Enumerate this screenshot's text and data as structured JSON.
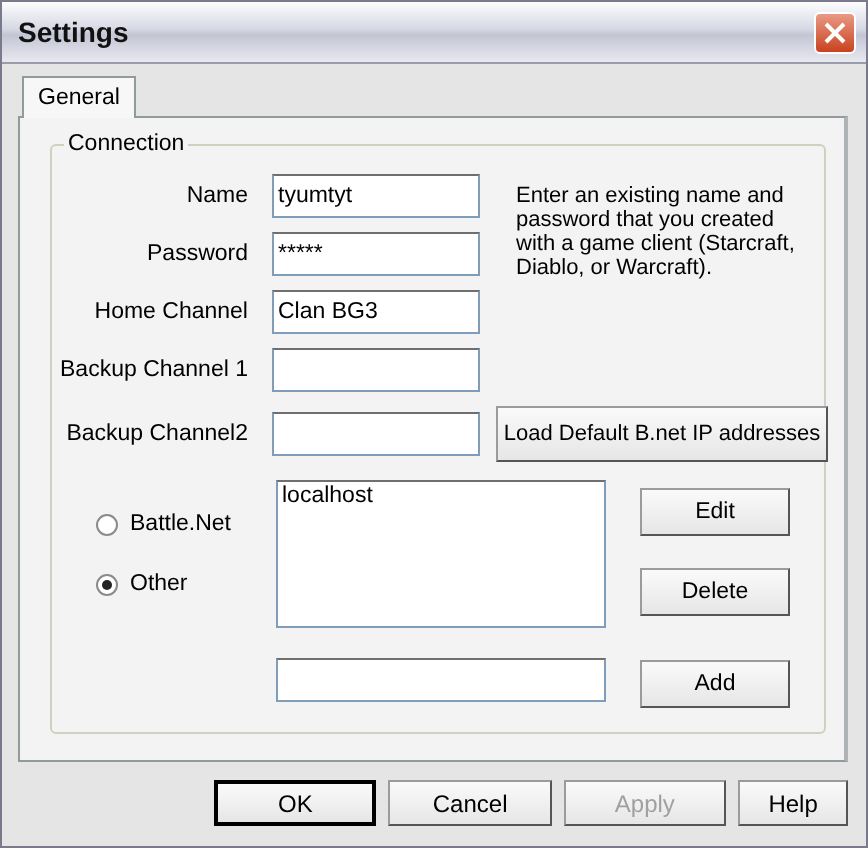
{
  "window": {
    "title": "Settings"
  },
  "tabs": [
    {
      "label": "General",
      "selected": true
    }
  ],
  "group": {
    "title": "Connection"
  },
  "fields": [
    {
      "label": "Name",
      "value": "tyumtyt"
    },
    {
      "label": "Password",
      "value": "*****"
    },
    {
      "label": "Home Channel",
      "value": "Clan BG3"
    },
    {
      "label": "Backup Channel 1"
    },
    {
      "label": "Backup Channel2"
    }
  ],
  "help_text": "Enter an existing name and password that you created with a game client (Starcraft, Diablo, or Warcraft).",
  "load_button": "Load Default B.net IP addresses",
  "radios": [
    {
      "label": "Battle.Net",
      "selected": false
    },
    {
      "label": "Other",
      "selected": true
    }
  ],
  "server_list": [
    "localhost"
  ],
  "list_buttons": [
    "Edit",
    "Delete",
    "Add"
  ],
  "buttons": [
    {
      "label": "OK",
      "default": true,
      "disabled": false
    },
    {
      "label": "Cancel",
      "default": false,
      "disabled": false
    },
    {
      "label": "Apply",
      "default": false,
      "disabled": true
    },
    {
      "label": "Help",
      "default": false,
      "disabled": false
    }
  ]
}
